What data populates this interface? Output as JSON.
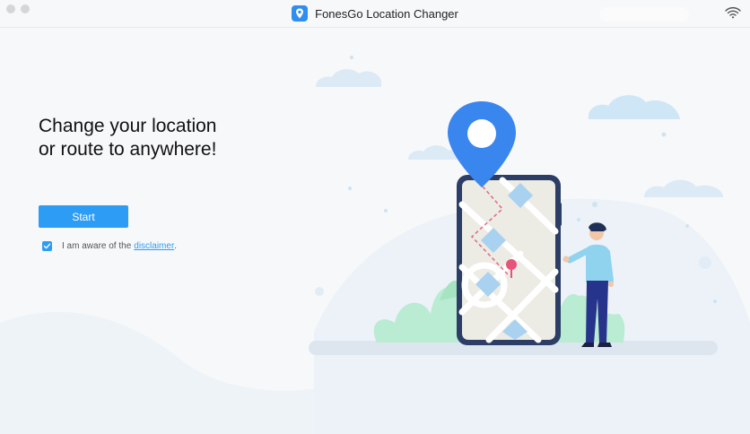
{
  "window": {
    "title": "FonesGo Location Changer"
  },
  "main": {
    "headline": "Change your location\nor route to anywhere!",
    "start_label": "Start",
    "consent": {
      "checked": true,
      "prefix": "I am aware of the",
      "link_text": "disclaimer",
      "suffix": "."
    }
  },
  "colors": {
    "accent": "#2d9cf4",
    "background": "#f7f8fa"
  },
  "icons": [
    "app-logo-icon",
    "wifi-icon",
    "checkmark-icon",
    "location-pin-icon"
  ]
}
